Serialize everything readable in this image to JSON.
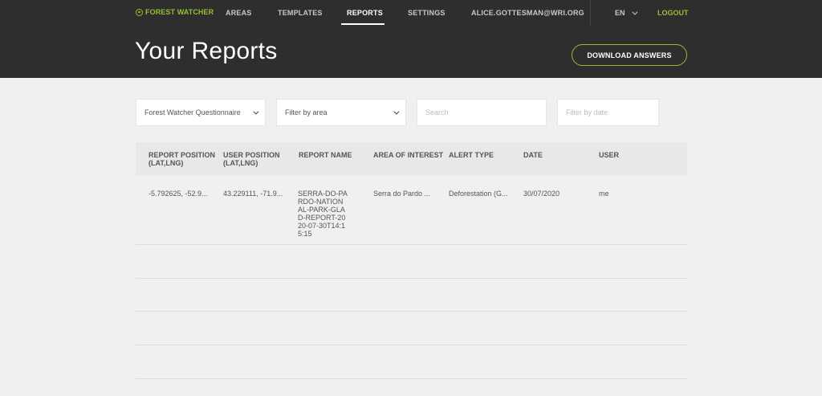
{
  "nav": {
    "brand": "FOREST WATCHER",
    "items": [
      {
        "label": "AREAS"
      },
      {
        "label": "TEMPLATES"
      },
      {
        "label": "REPORTS"
      },
      {
        "label": "SETTINGS"
      },
      {
        "label": "ALICE.GOTTESMAN@WRI.ORG"
      }
    ],
    "active": "REPORTS",
    "language": "EN",
    "logout": "LOGOUT"
  },
  "header": {
    "title": "Your Reports",
    "download_button": "DOWNLOAD ANSWERS"
  },
  "filters": {
    "template_select": "Forest Watcher Questionnaire",
    "area_select": "Filter by area",
    "search_placeholder": "Search",
    "date_placeholder": "Filter by date"
  },
  "table": {
    "columns": [
      "REPORT POSITION (LAT,LNG)",
      "USER POSITION (LAT,LNG)",
      "REPORT NAME",
      "AREA OF INTEREST",
      "ALERT TYPE",
      "DATE",
      "USER"
    ],
    "rows": [
      {
        "report_position": "-5.792625, -52.9...",
        "user_position": "43.229111, -71.9...",
        "report_name": "SERRA-DO-PARDO-NATIONAL-PARK-GLAD-REPORT-2020-07-30T14:15:15",
        "area": "Serra do Pardo ...",
        "alert_type": "Deforestation (G...",
        "date": "30/07/2020",
        "user": "me"
      }
    ]
  },
  "colors": {
    "brand_green": "#97be32",
    "dark_bg": "#2e2e2e",
    "page_bg": "#f0f0f0"
  }
}
